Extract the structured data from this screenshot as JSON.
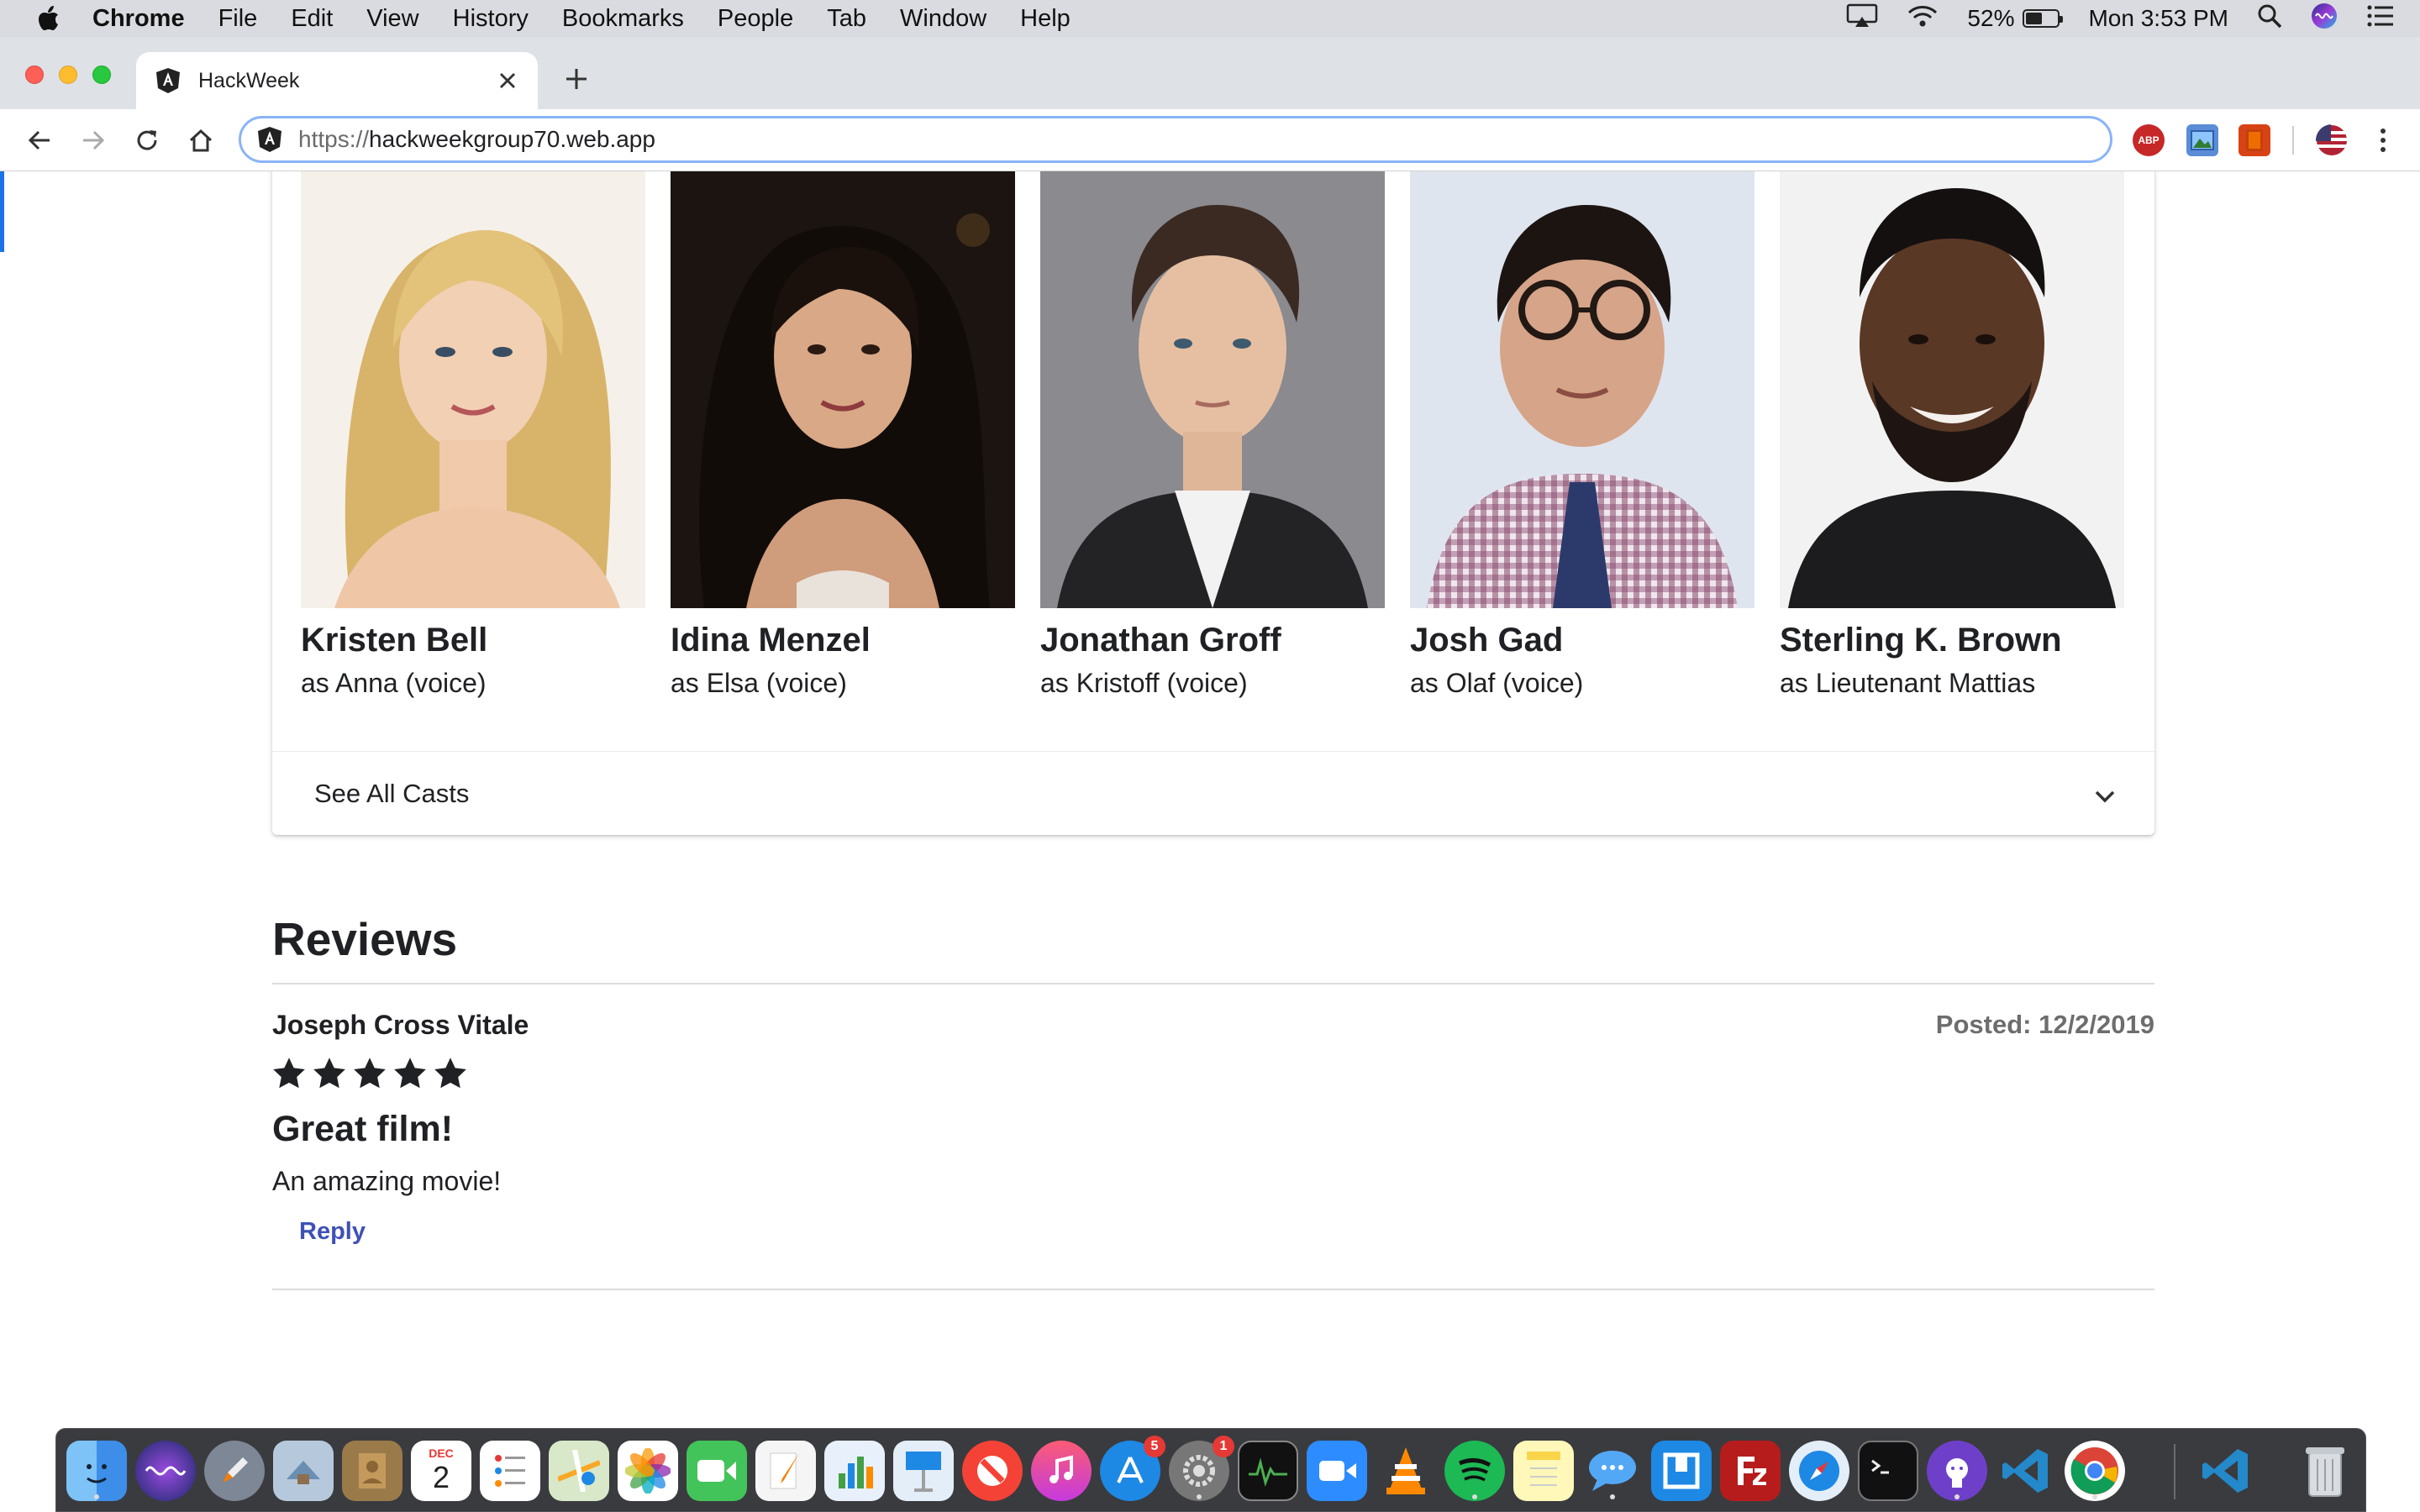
{
  "menubar": {
    "app_name": "Chrome",
    "items": [
      "File",
      "Edit",
      "View",
      "History",
      "Bookmarks",
      "People",
      "Tab",
      "Window",
      "Help"
    ],
    "battery_percent": "52%",
    "battery_level": 0.52,
    "clock": "Mon 3:53 PM"
  },
  "browser": {
    "tab_title": "HackWeek",
    "url_scheme": "https://",
    "url_host": "hackweekgroup70.web.app",
    "extensions": [
      "ABP"
    ]
  },
  "cast": {
    "members": [
      {
        "name": "Kristen Bell",
        "role": "as Anna (voice)"
      },
      {
        "name": "Idina Menzel",
        "role": "as Elsa (voice)"
      },
      {
        "name": "Jonathan Groff",
        "role": "as Kristoff (voice)"
      },
      {
        "name": "Josh Gad",
        "role": "as Olaf (voice)"
      },
      {
        "name": "Sterling K. Brown",
        "role": "as Lieutenant Mattias"
      }
    ],
    "see_all_label": "See All Casts"
  },
  "reviews": {
    "heading": "Reviews",
    "items": [
      {
        "author": "Joseph Cross Vitale",
        "posted": "Posted: 12/2/2019",
        "rating": 5,
        "title": "Great film!",
        "body": "An amazing movie!",
        "reply_label": "Reply"
      }
    ]
  },
  "dock": {
    "badges": {
      "app_store": "5",
      "system_preferences": "1"
    },
    "calendar": {
      "month": "DEC",
      "day": "2"
    }
  }
}
